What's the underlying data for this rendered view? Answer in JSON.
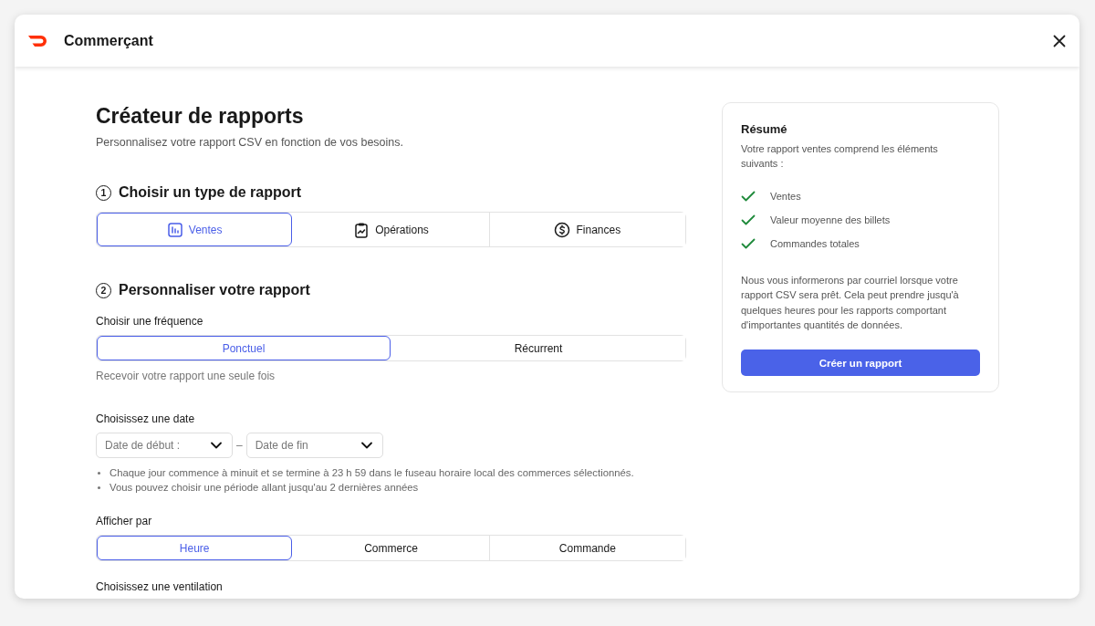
{
  "window": {
    "title": "Commerçant"
  },
  "page": {
    "title": "Créateur de rapports",
    "subtitle": "Personnalisez votre rapport CSV en fonction de vos besoins."
  },
  "step_1": {
    "number": "1",
    "title": "Choisir un type de rapport",
    "options": [
      {
        "label": "Ventes",
        "kind": "chart",
        "selected": true
      },
      {
        "label": "Opérations",
        "kind": "clipboard",
        "selected": false
      },
      {
        "label": "Finances",
        "kind": "dollar",
        "selected": false
      }
    ]
  },
  "step_2": {
    "number": "2",
    "title": "Personnaliser votre rapport",
    "frequency": {
      "label": "Choisir une fréquence",
      "options": [
        {
          "label": "Ponctuel",
          "selected": true
        },
        {
          "label": "Récurrent",
          "selected": false
        }
      ],
      "helper": "Recevoir votre rapport une seule fois"
    },
    "date": {
      "label": "Choisissez une date",
      "start_placeholder": "Date de début :",
      "separator": "–",
      "end_placeholder": "Date de fin",
      "notes": [
        "Chaque jour commence à minuit et se termine à 23 h 59 dans le fuseau horaire local des commerces sélectionnés.",
        "Vous pouvez choisir une période allant jusqu'au 2 dernières années"
      ]
    },
    "display_by": {
      "label": "Afficher par",
      "options": [
        {
          "label": "Heure",
          "selected": true
        },
        {
          "label": "Commerce",
          "selected": false
        },
        {
          "label": "Commande",
          "selected": false
        }
      ]
    },
    "breakdown": {
      "label": "Choisissez une ventilation"
    }
  },
  "summary": {
    "title": "Résumé",
    "intro": "Votre rapport ventes comprend les éléments suivants :",
    "items": [
      "Ventes",
      "Valeur moyenne des billets",
      "Commandes totales"
    ],
    "note": "Nous vous informerons par courriel lorsque votre rapport CSV sera prêt. Cela peut prendre jusqu'à quelques heures pour les rapports comportant d'importantes quantités de données.",
    "button": "Créer un rapport"
  }
}
